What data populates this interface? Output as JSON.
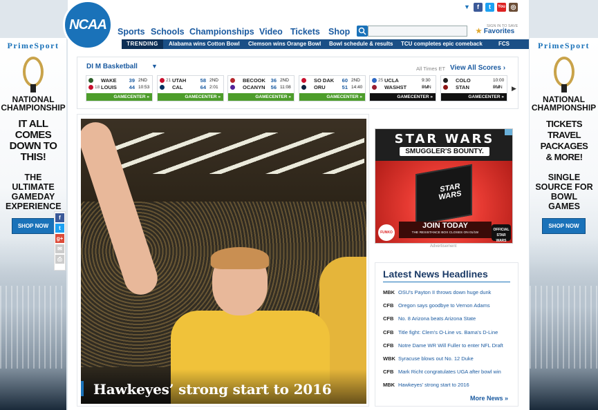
{
  "social": {
    "icons": [
      "facebook-icon",
      "twitter-icon",
      "youtube-icon",
      "instagram-icon"
    ]
  },
  "logo": "NCAA",
  "nav": [
    "Sports",
    "Schools",
    "Championships",
    "Video",
    "Tickets",
    "Shop"
  ],
  "search": {
    "placeholder": ""
  },
  "favorites": {
    "label": "Favorites",
    "hint": "SIGN IN TO SAVE"
  },
  "trending": {
    "label": "TRENDING",
    "items": [
      "Alabama wins Cotton Bowl",
      "Clemson wins Orange Bowl",
      "Bowl schedule & results",
      "TCU completes epic comeback",
      "FCS"
    ]
  },
  "scoreboard": {
    "title": "DI M Basketball",
    "dropdown": "▼",
    "time_note": "All Times ET",
    "view_all": "View All Scores ›",
    "games": [
      {
        "t1": {
          "rank": "",
          "name": "WAKE",
          "score": "39"
        },
        "t2": {
          "rank": "18",
          "name": "LOUIS",
          "score": "44"
        },
        "status1": "2ND",
        "status2": "10:53",
        "gc": "GAMECENTER »",
        "c1": "#2d5e2a",
        "c2": "#c8102e",
        "dark": false
      },
      {
        "t1": {
          "rank": "21",
          "name": "UTAH",
          "score": "58"
        },
        "t2": {
          "rank": "",
          "name": "CAL",
          "score": "64"
        },
        "status1": "2ND",
        "status2": "2:01",
        "gc": "GAMECENTER »",
        "c1": "#c8102e",
        "c2": "#003262",
        "dark": false
      },
      {
        "t1": {
          "rank": "",
          "name": "BECOOK",
          "score": "36"
        },
        "t2": {
          "rank": "",
          "name": "OCANYN",
          "score": "56"
        },
        "status1": "2ND",
        "status2": "11:08",
        "gc": "GAMECENTER »",
        "c1": "#b5272d",
        "c2": "#522398",
        "dark": false
      },
      {
        "t1": {
          "rank": "",
          "name": "SO DAK",
          "score": "60"
        },
        "t2": {
          "rank": "",
          "name": "ORU",
          "score": "51"
        },
        "status1": "2ND",
        "status2": "14:40",
        "gc": "GAMECENTER »",
        "c1": "#c8102e",
        "c2": "#0c2340",
        "dark": false
      },
      {
        "t1": {
          "rank": "25",
          "name": "UCLA",
          "score": ""
        },
        "t2": {
          "rank": "",
          "name": "WASHST",
          "score": ""
        },
        "status1": "9:30 PM",
        "status2": "SUN",
        "gc": "GAMECENTER »",
        "c1": "#2d68c4",
        "c2": "#981e32",
        "dark": true
      },
      {
        "t1": {
          "rank": "",
          "name": "COLO",
          "score": ""
        },
        "t2": {
          "rank": "",
          "name": "STAN",
          "score": ""
        },
        "status1": "10:00 PM",
        "status2": "SUN",
        "gc": "GAMECENTER »",
        "c1": "#222222",
        "c2": "#8c1515",
        "dark": true
      }
    ]
  },
  "hero": {
    "caption": "Hawkeyes’ strong start to 2016"
  },
  "left_ad": {
    "brand": "PrimeSport",
    "headline": "NATIONAL CHAMPIONSHIP",
    "line1": "IT ALL COMES DOWN TO THIS!",
    "line2": "THE ULTIMATE GAMEDAY EXPERIENCE",
    "button": "SHOP NOW"
  },
  "right_ad": {
    "brand": "PrimeSport",
    "headline": "NATIONAL CHAMPIONSHIP",
    "line1": "TICKETS TRAVEL PACKAGES & MORE!",
    "line2": "SINGLE SOURCE FOR BOWL GAMES",
    "button": "SHOP NOW"
  },
  "sw_ad": {
    "title": "STAR WARS",
    "subtitle": "SMUGGLER'S BOUNTY.",
    "box": "STAR WARS",
    "cta": "JOIN TODAY",
    "fine": "THE RESISTANCE BOX CLOSES ON 01/15!",
    "funko": "FUNKO",
    "official": "OFFICIAL STAR WARS",
    "label": "Advertisement"
  },
  "news": {
    "title": "Latest News Headlines",
    "items": [
      {
        "tag": "MBK",
        "text": "OSU's Payton II throws down huge dunk"
      },
      {
        "tag": "CFB",
        "text": "Oregon says goodbye to Vernon Adams"
      },
      {
        "tag": "CFB",
        "text": "No. 8 Arizona beats Arizona State"
      },
      {
        "tag": "CFB",
        "text": "Title fight: Clem's O-Line vs. Bama's D-Line"
      },
      {
        "tag": "CFB",
        "text": "Notre Dame WR Will Fuller to enter NFL Draft"
      },
      {
        "tag": "WBK",
        "text": "Syracuse blows out No. 12 Duke"
      },
      {
        "tag": "CFB",
        "text": "Mark Richt congratulates UGA after bowl win"
      },
      {
        "tag": "MBK",
        "text": "Hawkeyes' strong start to 2016"
      }
    ],
    "more": "More News »"
  }
}
